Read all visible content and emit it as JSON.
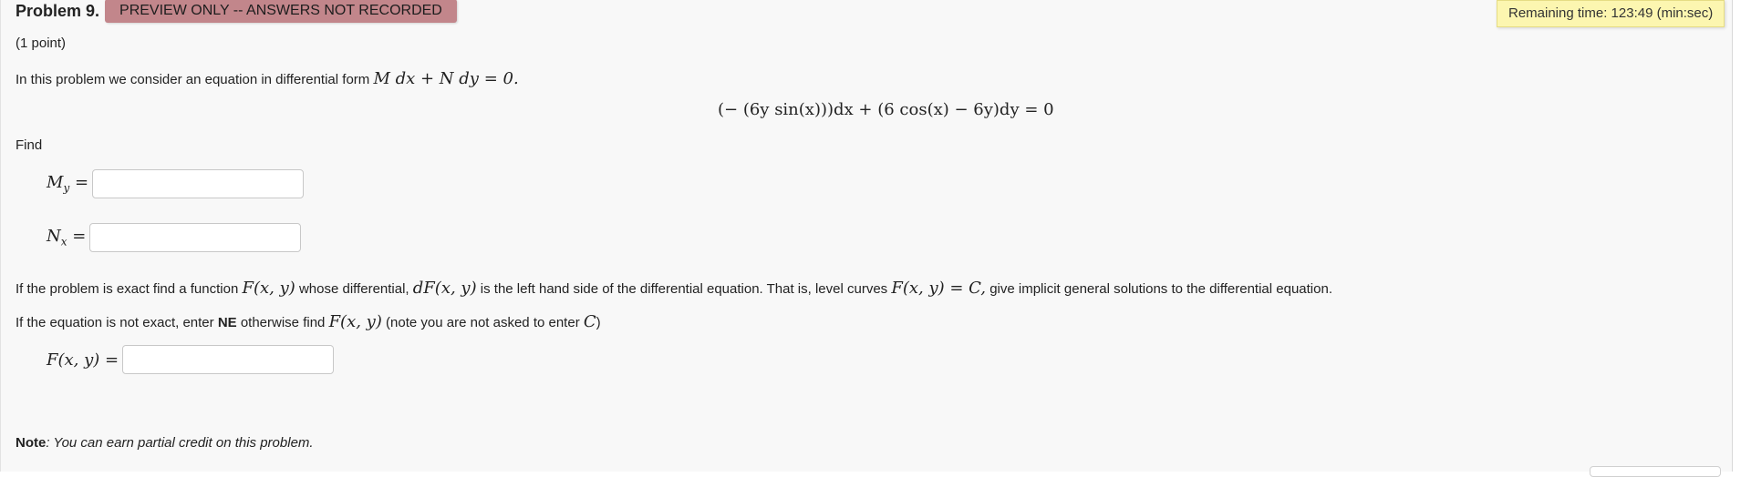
{
  "problem": {
    "number_label": "Problem 9.",
    "preview_badge": "PREVIEW ONLY -- ANSWERS NOT RECORDED",
    "remaining_time": "Remaining time: 123:49 (min:sec)",
    "points": "(1 point)",
    "intro_text": "In this problem we consider an equation in differential form",
    "intro_math": "M dx + N dy = 0.",
    "equation": "(− (6y sin(x)))dx + (6 cos(x) − 6y)dy = 0",
    "find_label": "Find",
    "my_label": "M",
    "my_sub": "y",
    "nx_label": "N",
    "nx_sub": "x",
    "exact_text_1": "If the problem is exact find a function",
    "exact_math_1": "F(x, y)",
    "exact_text_2": "whose differential,",
    "exact_math_2": "dF(x, y)",
    "exact_text_3": "is the left hand side of the differential equation. That is, level curves",
    "exact_math_3": "F(x, y) = C,",
    "exact_text_4": "give implicit general solutions to the differential equation.",
    "ne_text_1": "If the equation is not exact, enter",
    "ne_bold": "NE",
    "ne_text_2": "otherwise find",
    "ne_math_1": "F(x, y)",
    "ne_text_3": "(note you are not asked to enter",
    "ne_math_2": "C",
    "ne_text_4": ")",
    "f_label": "F(x, y) =",
    "note_label": "Note",
    "note_text": ": You can earn partial credit on this problem."
  },
  "inputs": {
    "my_value": "",
    "nx_value": "",
    "f_value": ""
  },
  "colors": {
    "badge": "#c2868b",
    "timer_bg": "#fcf6b0",
    "panel_bg": "#f8f8f8"
  }
}
